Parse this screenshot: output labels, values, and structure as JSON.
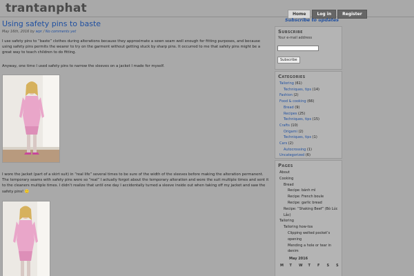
{
  "site": {
    "title": "trantanphat"
  },
  "nav": {
    "home": "Home",
    "login": "Log in",
    "register": "Register"
  },
  "post": {
    "title": "Using safety pins to baste",
    "date": "May 16th, 2016 by",
    "author": "wpr",
    "separator": "/",
    "comments": "No comments yet",
    "para1": "I use safety pins to “baste” clothes during alterations because they approximate a sewn seam well enough for fitting purposes, and because using safety pins permits the wearer to try on the garment without getting stuck by sharp pins. It occurred to me that safety pins might be a great way to teach children to do fitting.",
    "para2": "Anyway, one time I used safety pins to narrow the sleeves on a jacket I made for myself.",
    "para3": "I wore the jacket (part of a skirt suit) in “real life” several times to be sure of the width of the sleeves before making the alteration permanent. The temporary seams with safety pins were so “real” I actually forgot about the temporary alteration and wore the suit multiple times and sent it to the cleaners multiple times. I didn’t realize that until one day I accidentally turned a sleeve inside out when taking off my jacket and saw the safety pins! 🙂"
  },
  "sidebar": {
    "subscribe_link": "Subscribe to updates",
    "subscribe": {
      "title": "Subscribe",
      "label": "Your e-mail address",
      "button": "Subscribe"
    },
    "categories": {
      "title": "Categories",
      "items": [
        {
          "name": "Tailoring",
          "count": "(61)",
          "level": 0
        },
        {
          "name": "Techniques, tips",
          "count": "(14)",
          "level": 1
        },
        {
          "name": "Fashion",
          "count": "(2)",
          "level": 0
        },
        {
          "name": "Food & cooking",
          "count": "(66)",
          "level": 0
        },
        {
          "name": "Bread",
          "count": "(9)",
          "level": 1
        },
        {
          "name": "Recipes",
          "count": "(25)",
          "level": 1
        },
        {
          "name": "Techniques, tips",
          "count": "(15)",
          "level": 1
        },
        {
          "name": "Crafts",
          "count": "(10)",
          "level": 0
        },
        {
          "name": "Origami",
          "count": "(2)",
          "level": 1
        },
        {
          "name": "Techniques, tips",
          "count": "(1)",
          "level": 1
        },
        {
          "name": "Cars",
          "count": "(2)",
          "level": 0
        },
        {
          "name": "Autocrossing",
          "count": "(1)",
          "level": 1
        },
        {
          "name": "Uncategorized",
          "count": "(6)",
          "level": 0
        }
      ]
    },
    "pages": {
      "title": "Pages",
      "items": [
        {
          "name": "About",
          "level": 0
        },
        {
          "name": "Cooking",
          "level": 0
        },
        {
          "name": "Bread",
          "level": 1
        },
        {
          "name": "Recipe: bánh mì",
          "level": 2
        },
        {
          "name": "Recipe: French boule",
          "level": 2
        },
        {
          "name": "Recipe: garlic bread",
          "level": 2
        },
        {
          "name": "Recipe: “Shaking Beef” (Bò Lúc",
          "level": 1
        },
        {
          "name": "Lắc)",
          "level": 1
        },
        {
          "name": "Tailoring",
          "level": 0
        },
        {
          "name": "Tailoring how-tos",
          "level": 1
        },
        {
          "name": "Clipping welted pocket’s",
          "level": 2
        },
        {
          "name": "opening",
          "level": 2
        },
        {
          "name": "Mending a hole or tear in",
          "level": 2
        },
        {
          "name": "denim",
          "level": 2
        }
      ]
    },
    "calendar": {
      "title": "May 2016",
      "days": [
        "M",
        "T",
        "W",
        "T",
        "F",
        "S",
        "S"
      ]
    }
  }
}
